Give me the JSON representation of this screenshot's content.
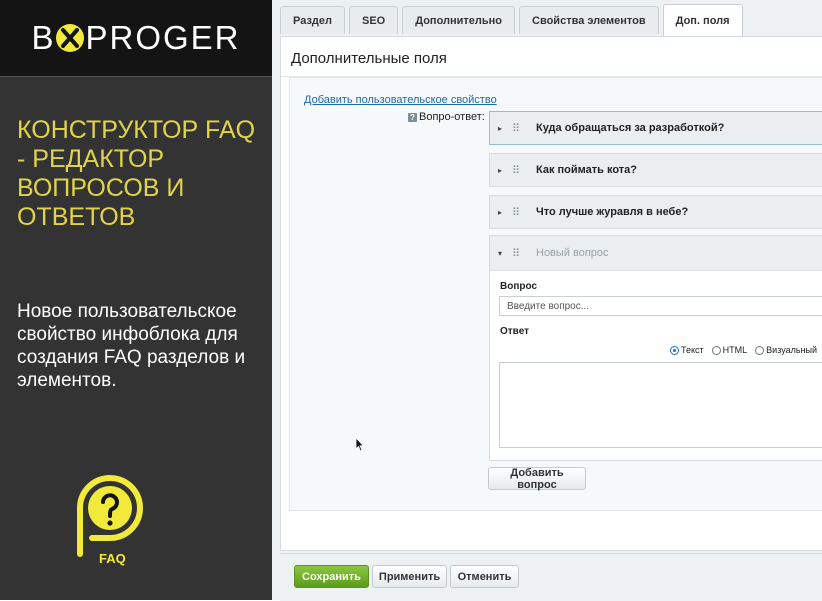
{
  "brand": {
    "logo_left": "B",
    "logo_right": "PROGER",
    "accent": "#f2ea3a"
  },
  "promo": {
    "title": "КОНСТРУКТОР FAQ - РЕДАКТОР ВОПРОСОВ И ОТВЕТОВ",
    "description": "Новое пользовательское свойство инфоблока для создания FAQ разделов и элементов.",
    "faq_logo_label": "FAQ"
  },
  "tabs": [
    {
      "label": "Раздел",
      "active": false
    },
    {
      "label": "SEO",
      "active": false
    },
    {
      "label": "Дополнительно",
      "active": false
    },
    {
      "label": "Свойства элементов",
      "active": false
    },
    {
      "label": "Доп. поля",
      "active": true
    }
  ],
  "panel": {
    "title": "Дополнительные поля",
    "add_property_link": "Добавить пользовательское свойство",
    "property_label": "Вопро-ответ:",
    "help_icon_glyph": "?"
  },
  "questions": [
    {
      "text": "Куда обращаться за разработкой?"
    },
    {
      "text": "Как поймать кота?"
    },
    {
      "text": "Что лучше журавля в небе?"
    }
  ],
  "new_question": {
    "header_placeholder": "Новый вопрос",
    "question_label": "Вопрос",
    "question_placeholder": "Введите вопрос...",
    "answer_label": "Ответ",
    "answer_formats": [
      {
        "label": "Текст",
        "checked": true
      },
      {
        "label": "HTML",
        "checked": false
      },
      {
        "label": "Визуальный",
        "checked": false
      }
    ]
  },
  "buttons": {
    "add_question": "Добавить вопрос",
    "save": "Сохранить",
    "apply": "Применить",
    "cancel": "Отменить"
  },
  "icons": {
    "expand": "▸",
    "collapse": "▾",
    "drag": "⠿"
  },
  "colors": {
    "promo_title": "#e2d44a",
    "link": "#2067b0",
    "save_button": "#6aa82a"
  }
}
